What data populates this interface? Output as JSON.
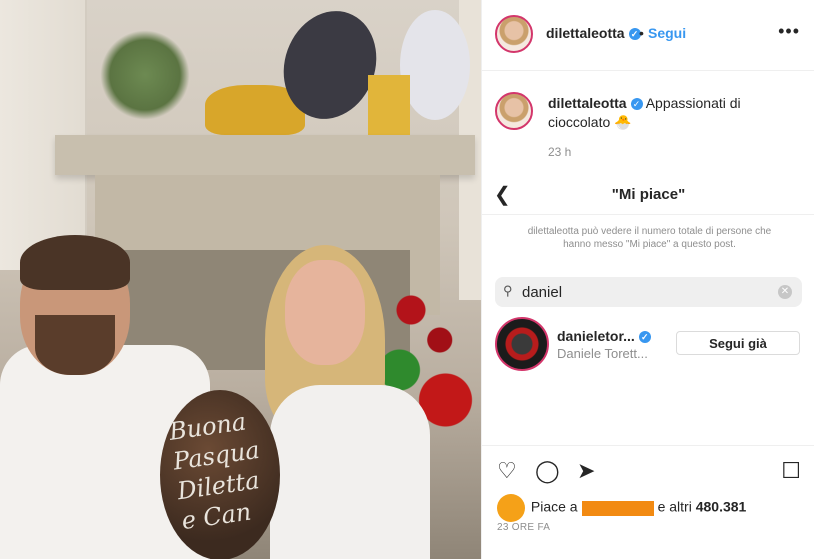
{
  "post": {
    "username": "dilettaleotta",
    "follow_label": "Segui",
    "separator": "•",
    "more_label": "•••"
  },
  "caption": {
    "username": "dilettaleotta",
    "text": "Appassionati di cioccolato 🐣",
    "time": "23 h"
  },
  "likes_dialog": {
    "back_icon": "chevron-left-icon",
    "title": "\"Mi piace\"",
    "notice": "dilettaleotta può vedere il numero totale di persone che hanno messo \"Mi piace\" a questo post.",
    "search_value": "daniel",
    "result": {
      "username": "danieletor...",
      "full_name": "Daniele Torett...",
      "button_label": "Segui già"
    }
  },
  "photo": {
    "egg_writing": "Buona Pasqua Diletta e Can"
  },
  "footer": {
    "likes_prefix": "Piace a",
    "likes_suffix": "e altri",
    "likes_count": "480.381",
    "timestamp": "23 ORE FA"
  },
  "colors": {
    "accent": "#3897f0",
    "story_ring": "#d3366b",
    "redaction": "#f28a12"
  }
}
